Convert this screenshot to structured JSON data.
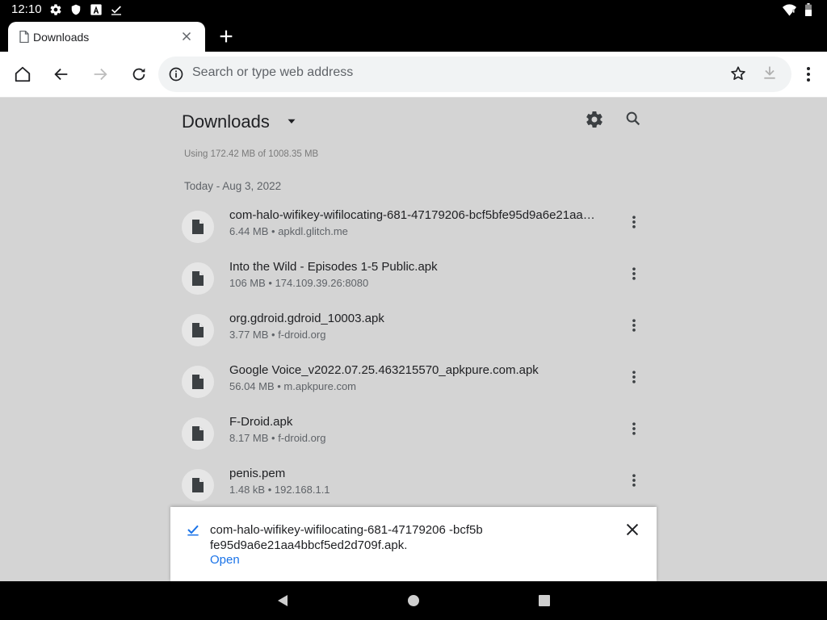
{
  "status_bar": {
    "time": "12:10"
  },
  "tab": {
    "title": "Downloads"
  },
  "omnibox": {
    "placeholder": "Search or type web address"
  },
  "downloads": {
    "title": "Downloads",
    "storage": "Using 172.42 MB of 1008.35 MB",
    "date_header": "Today - Aug 3, 2022",
    "items": [
      {
        "name": "com-halo-wifikey-wifilocating-681-47179206-bcf5bfe95d9a6e21aa4bbcf5ed2d709f.apk",
        "meta": "6.44 MB • apkdl.glitch.me"
      },
      {
        "name": "Into the Wild - Episodes 1-5 Public.apk",
        "meta": "106 MB • 174.109.39.26:8080"
      },
      {
        "name": "org.gdroid.gdroid_10003.apk",
        "meta": "3.77 MB • f-droid.org"
      },
      {
        "name": "Google Voice_v2022.07.25.463215570_apkpure.com.apk",
        "meta": "56.04 MB • m.apkpure.com"
      },
      {
        "name": "F-Droid.apk",
        "meta": "8.17 MB • f-droid.org"
      },
      {
        "name": "penis.pem",
        "meta": "1.48 kB • 192.168.1.1"
      }
    ]
  },
  "snackbar": {
    "message": "com-halo-wifikey-wifilocating-681-47179206 -bcf5bfe95d9a6e21aa4bbcf5ed2d709f.apk.",
    "action": "Open"
  },
  "colors": {
    "accent": "#1a73e8",
    "background": "#d4d4d4",
    "status_bar": "#000000"
  }
}
